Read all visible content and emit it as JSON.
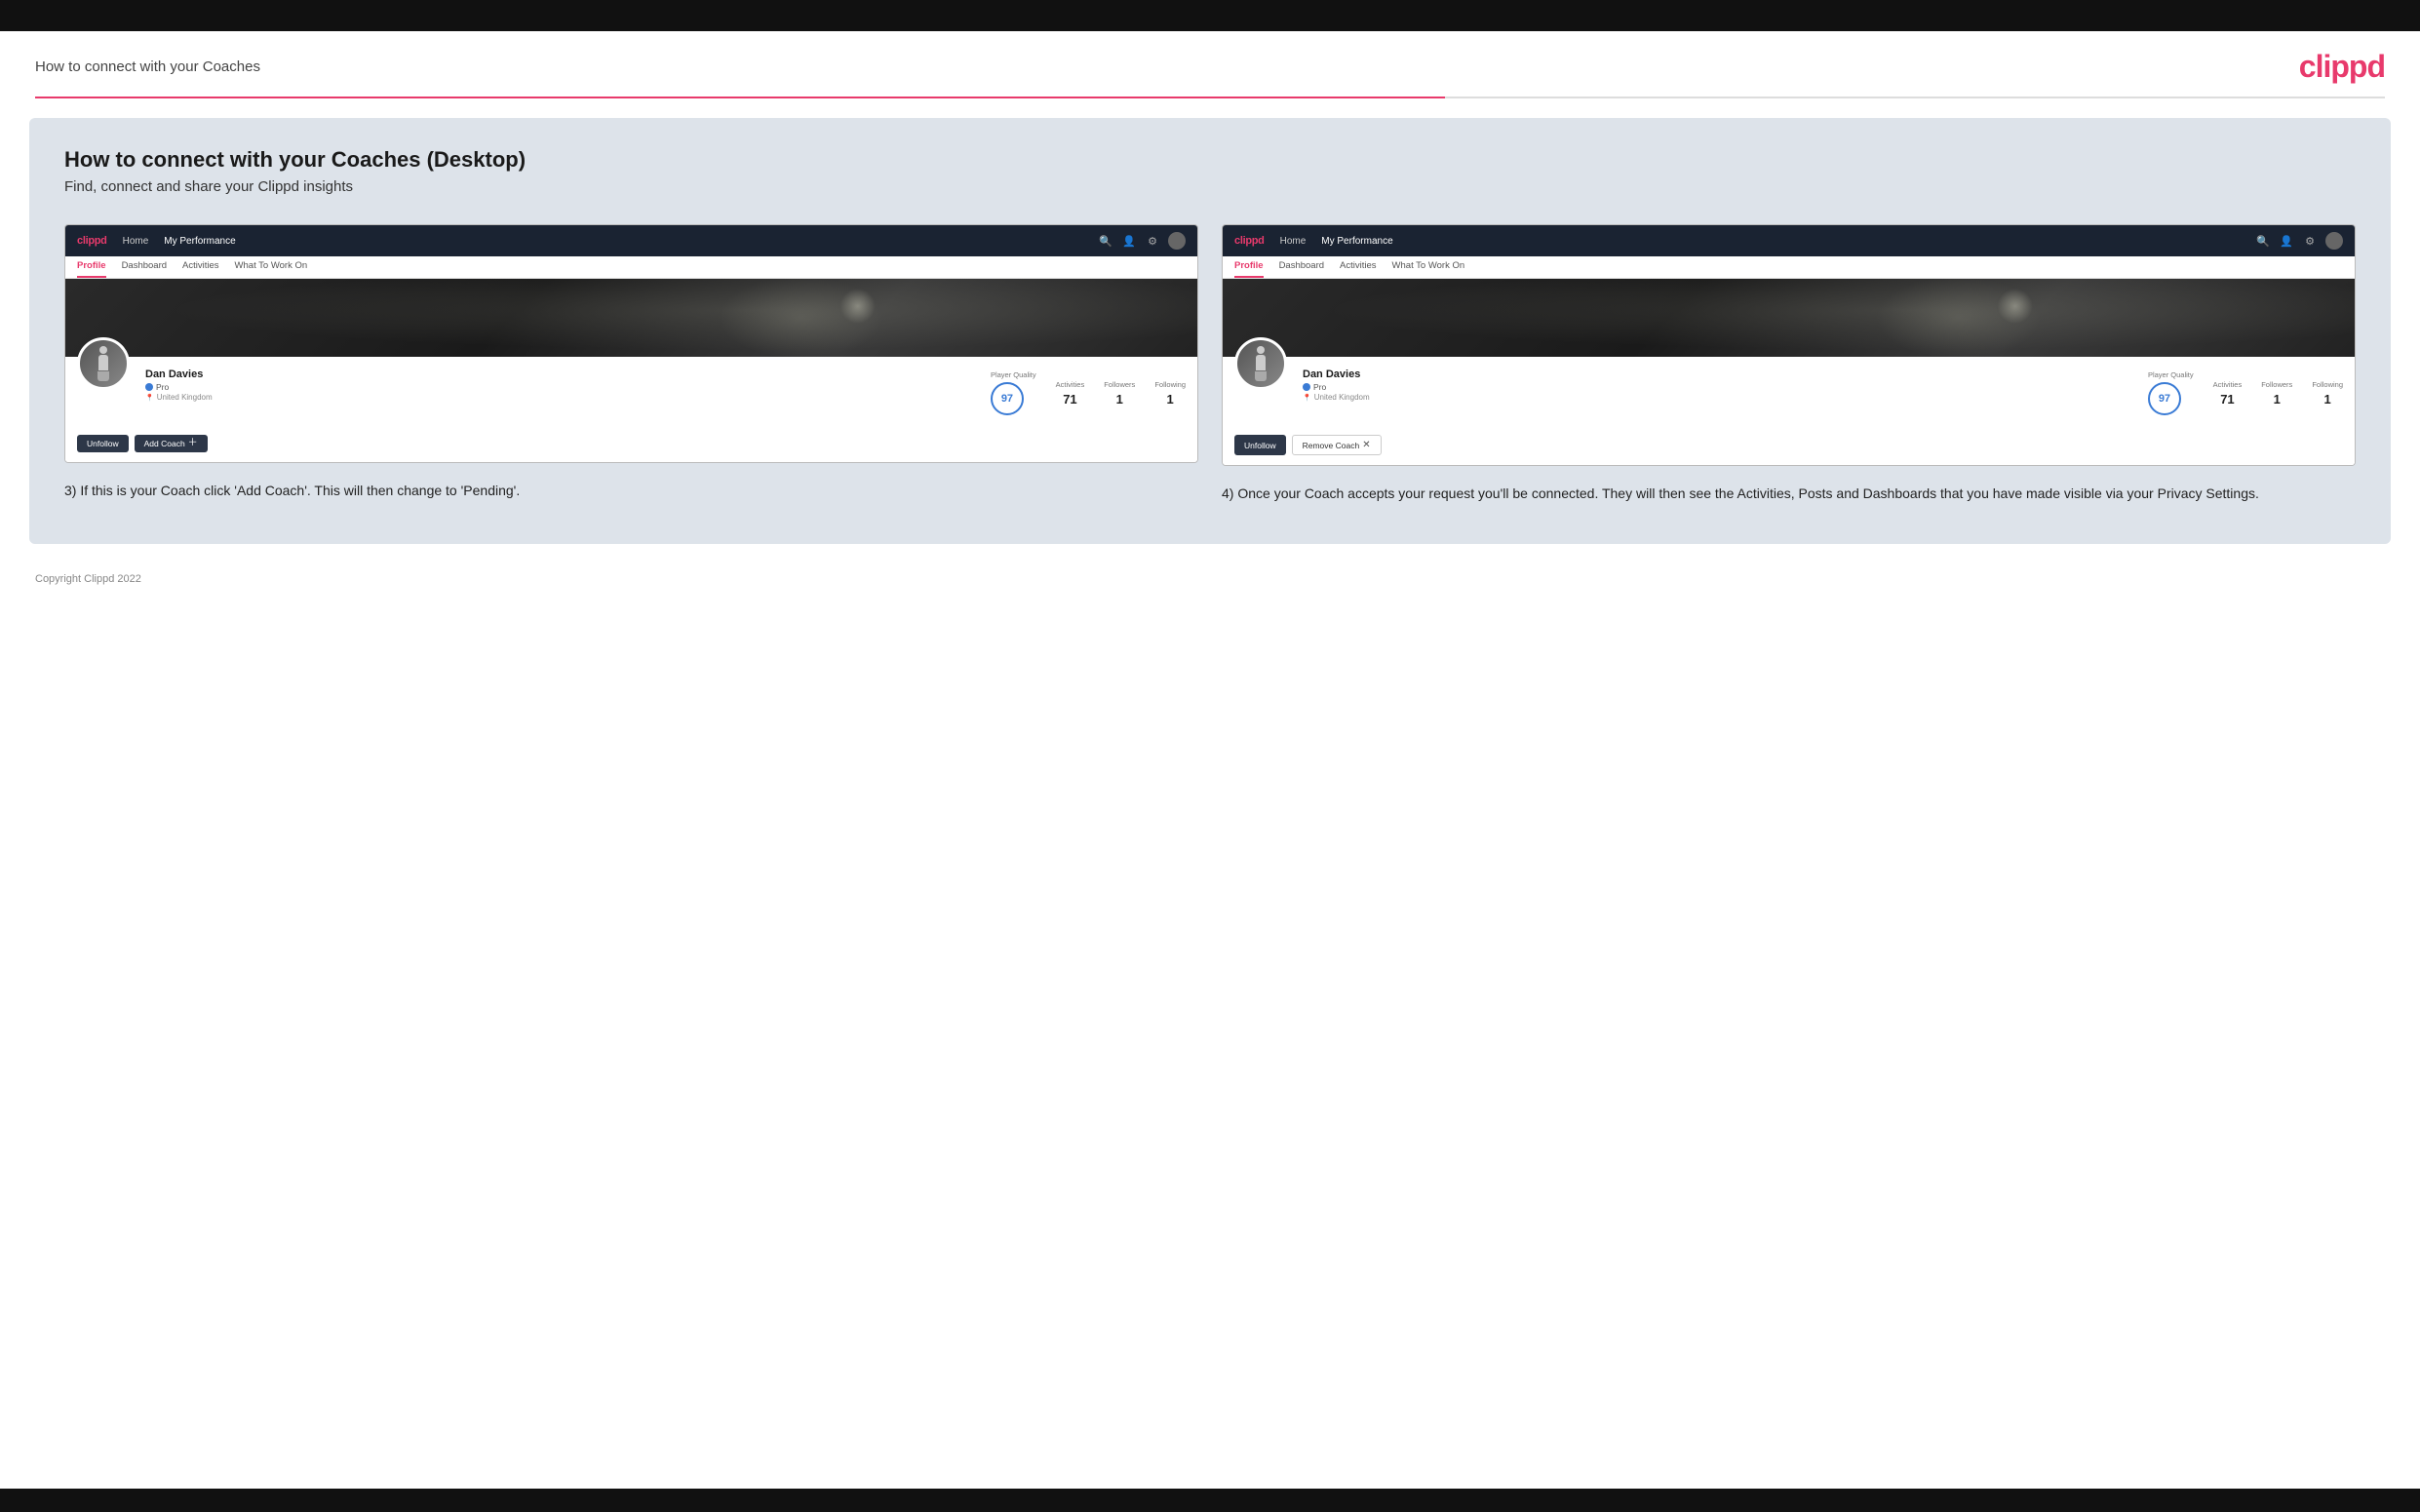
{
  "top_bar": {},
  "header": {
    "title": "How to connect with your Coaches",
    "logo": "clippd"
  },
  "main": {
    "heading": "How to connect with your Coaches (Desktop)",
    "subheading": "Find, connect and share your Clippd insights",
    "screenshot_left": {
      "nav": {
        "logo": "clippd",
        "links": [
          "Home",
          "My Performance"
        ],
        "active_link": "My Performance"
      },
      "tabs": [
        "Profile",
        "Dashboard",
        "Activities",
        "What To Work On"
      ],
      "active_tab": "Profile",
      "profile": {
        "name": "Dan Davies",
        "role": "Pro",
        "location": "United Kingdom",
        "player_quality": "97",
        "activities": "71",
        "followers": "1",
        "following": "1"
      },
      "actions": {
        "unfollow_label": "Unfollow",
        "add_coach_label": "Add Coach"
      }
    },
    "screenshot_right": {
      "nav": {
        "logo": "clippd",
        "links": [
          "Home",
          "My Performance"
        ],
        "active_link": "My Performance"
      },
      "tabs": [
        "Profile",
        "Dashboard",
        "Activities",
        "What To Work On"
      ],
      "active_tab": "Profile",
      "profile": {
        "name": "Dan Davies",
        "role": "Pro",
        "location": "United Kingdom",
        "player_quality": "97",
        "activities": "71",
        "followers": "1",
        "following": "1"
      },
      "actions": {
        "unfollow_label": "Unfollow",
        "remove_coach_label": "Remove Coach"
      }
    },
    "caption_left": "3) If this is your Coach click 'Add Coach'. This will then change to 'Pending'.",
    "caption_right": "4) Once your Coach accepts your request you'll be connected. They will then see the Activities, Posts and Dashboards that you have made visible via your Privacy Settings."
  },
  "footer": {
    "copyright": "Copyright Clippd 2022"
  },
  "stats_labels": {
    "player_quality": "Player Quality",
    "activities": "Activities",
    "followers": "Followers",
    "following": "Following"
  }
}
